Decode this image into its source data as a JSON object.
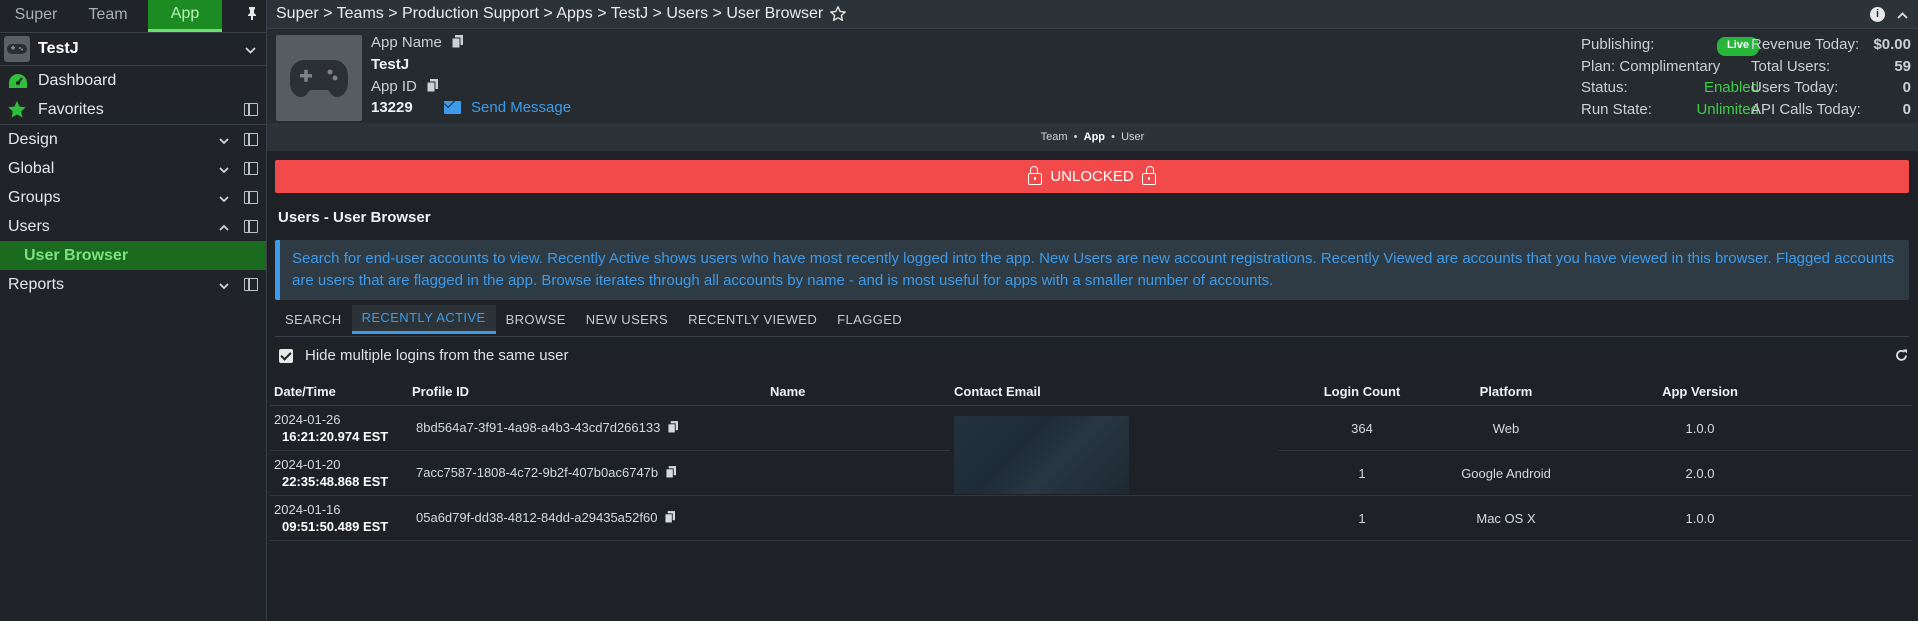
{
  "sidebar": {
    "tabs": [
      "Super",
      "Team",
      "App"
    ],
    "active_tab": "App",
    "app_name": "TestJ",
    "items": [
      {
        "label": "Dashboard"
      },
      {
        "label": "Favorites"
      },
      {
        "label": "Design"
      },
      {
        "label": "Global"
      },
      {
        "label": "Groups"
      },
      {
        "label": "Users"
      },
      {
        "label": "User Browser"
      },
      {
        "label": "Reports"
      }
    ]
  },
  "topbar": {
    "breadcrumb": "Super > Teams > Production Support > Apps > TestJ > Users > User Browser"
  },
  "app": {
    "name_label": "App Name",
    "name": "TestJ",
    "id_label": "App ID",
    "id": "13229",
    "send_message": "Send Message",
    "publishing_label": "Publishing:",
    "publishing_value": "Live",
    "plan": "Plan: Complimentary",
    "status_label": "Status:",
    "status_value": "Enabled",
    "runstate_label": "Run State:",
    "runstate_value": "Unlimited",
    "revenue_label": "Revenue Today:",
    "revenue_value": "$0.00",
    "total_users_label": "Total Users:",
    "total_users_value": "59",
    "users_today_label": "Users Today:",
    "users_today_value": "0",
    "api_calls_label": "API Calls Today:",
    "api_calls_value": "0"
  },
  "scope": {
    "team": "Team",
    "app": "App",
    "user": "User"
  },
  "unlocked_label": "UNLOCKED",
  "section_title": "Users - User Browser",
  "info_text": "Search for end-user accounts to view. Recently Active shows users who have most recently logged into the app. New Users are new account registrations. Recently Viewed are accounts that you have viewed in this browser. Flagged accounts are users that are flagged in the app. Browse iterates through all accounts by name - and is most useful for apps with a smaller number of accounts.",
  "tabs": [
    "SEARCH",
    "RECENTLY ACTIVE",
    "BROWSE",
    "NEW USERS",
    "RECENTLY VIEWED",
    "FLAGGED"
  ],
  "active_tab": "RECENTLY ACTIVE",
  "hide_multiple_label": "Hide multiple logins from the same user",
  "table": {
    "headers": [
      "Date/Time",
      "Profile ID",
      "Name",
      "Contact Email",
      "Login Count",
      "Platform",
      "App Version"
    ],
    "rows": [
      {
        "date": "2024-01-26",
        "time": "16:21:20.974 EST",
        "profile_id": "8bd564a7-3f91-4a98-a4b3-43cd7d266133",
        "name": "",
        "email": "",
        "login_count": "364",
        "platform": "Web",
        "version": "1.0.0"
      },
      {
        "date": "2024-01-20",
        "time": "22:35:48.868 EST",
        "profile_id": "7acc7587-1808-4c72-9b2f-407b0ac6747b",
        "name": "",
        "email": "",
        "login_count": "1",
        "platform": "Google Android",
        "version": "2.0.0"
      },
      {
        "date": "2024-01-16",
        "time": "09:51:50.489 EST",
        "profile_id": "05a6d79f-dd38-4812-84dd-a29435a52f60",
        "name": "",
        "email": "",
        "login_count": "1",
        "platform": "Mac OS X",
        "version": "1.0.0"
      }
    ]
  }
}
